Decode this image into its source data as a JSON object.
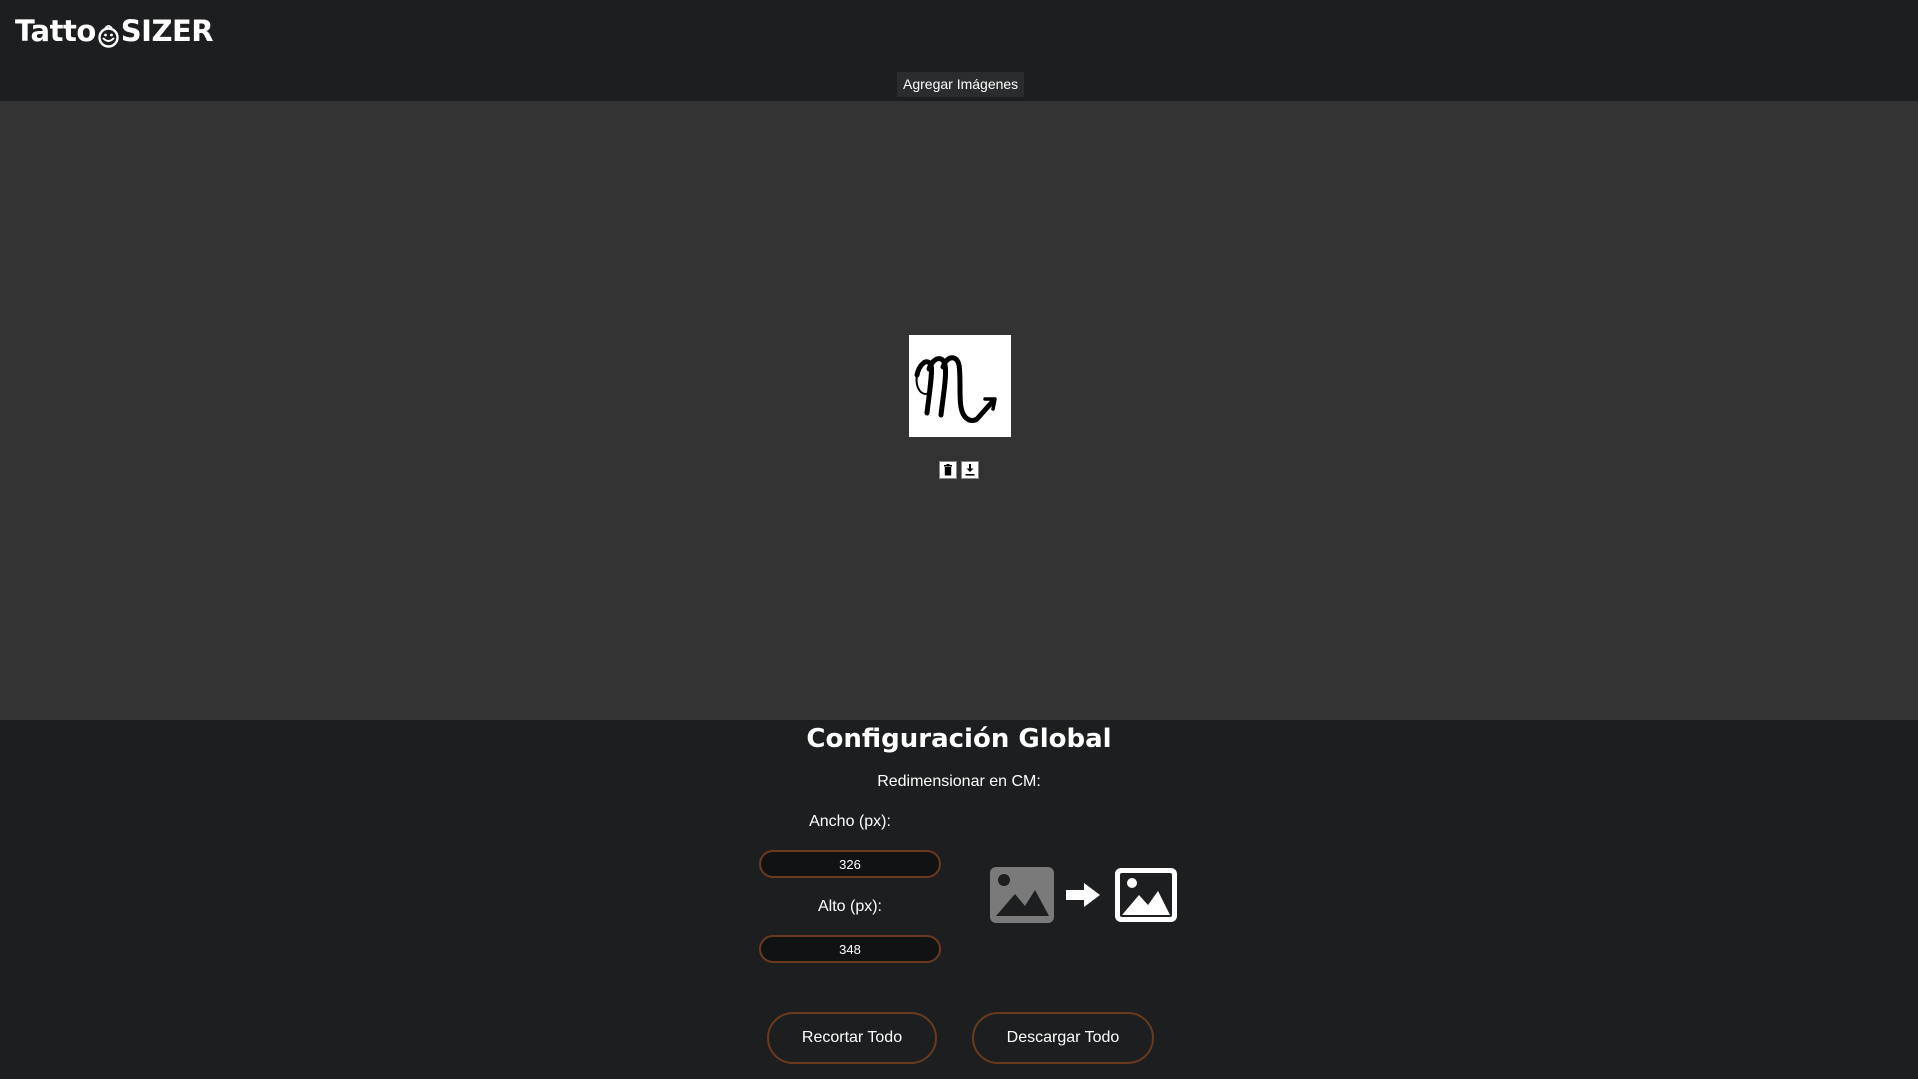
{
  "header": {
    "logo_left": "Tatto",
    "logo_right": "SIZER",
    "add_images_label": "Agregar Imágenes"
  },
  "gallery": {
    "image_glyph": "m-scorpio-glyph",
    "delete_icon": "trash-icon",
    "download_icon": "download-icon"
  },
  "config": {
    "title": "Configuración Global",
    "subtitle": "Redimensionar en CM:",
    "width_label": "Ancho (px):",
    "width_value": "326",
    "height_label": "Alto (px):",
    "height_value": "348",
    "illustration": [
      "image-icon",
      "arrow-right-icon",
      "image-icon"
    ]
  },
  "actions": {
    "crop_all_label": "Recortar Todo",
    "download_all_label": "Descargar Todo"
  },
  "colors": {
    "background": "#1c1e1f",
    "canvas": "#333333",
    "accent_border": "#6b3a1e"
  }
}
